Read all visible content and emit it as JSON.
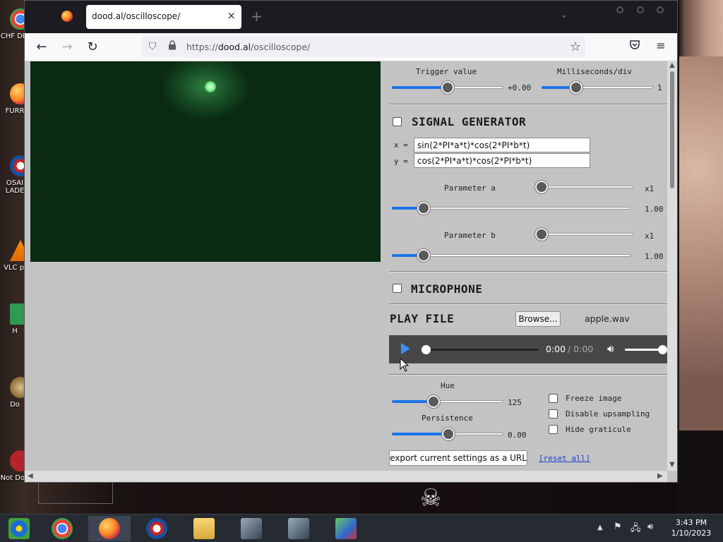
{
  "desktop": {
    "icons": [
      {
        "label": "CHF DIS"
      },
      {
        "label": "FURR"
      },
      {
        "label": "OSAI LADE"
      },
      {
        "label": "VLC pl"
      },
      {
        "label": "H"
      },
      {
        "label": "Do"
      },
      {
        "label": "Not Dog"
      }
    ]
  },
  "browser": {
    "tab_title": "dood.al/oscilloscope/",
    "tab_close": "×",
    "new_tab": "+",
    "url_prefix": "https://",
    "url_domain": "dood.al",
    "url_path": "/oscilloscope/"
  },
  "controls": {
    "trigger_value_label": "Trigger value",
    "trigger_value": "+0.00",
    "trigger_fraction": 0.5,
    "ms_div_label": "Milliseconds/div",
    "ms_div_value": "1",
    "ms_div_fraction": 0.31,
    "signal_generator_heading": "SIGNAL GENERATOR",
    "x_label": "x =",
    "x_expr": "sin(2*PI*a*t)*cos(2*PI*b*t)",
    "y_label": "y =",
    "y_expr": "cos(2*PI*a*t)*cos(2*PI*b*t)",
    "param_a_label": "Parameter a",
    "param_a_mult": "x1",
    "param_a_value": "1.00",
    "param_b_label": "Parameter b",
    "param_b_mult": "x1",
    "param_b_value": "1.00",
    "microphone_heading": "MICROPHONE",
    "play_file_heading": "PLAY FILE",
    "browse_label": "Browse...",
    "file_name": "apple.wav",
    "audio_time": "0:00",
    "audio_duration": "/ 0:00",
    "hue_label": "Hue",
    "hue_value": "125",
    "persistence_label": "Persistence",
    "persistence_value": "0.00",
    "freeze_label": "Freeze image",
    "disable_upsampling_label": "Disable upsampling",
    "hide_graticule_label": "Hide graticule",
    "export_label": "export current settings as a URL",
    "reset_label": "[reset all]"
  },
  "taskbar": {
    "time": "3:43 PM",
    "date": "1/10/2023"
  }
}
